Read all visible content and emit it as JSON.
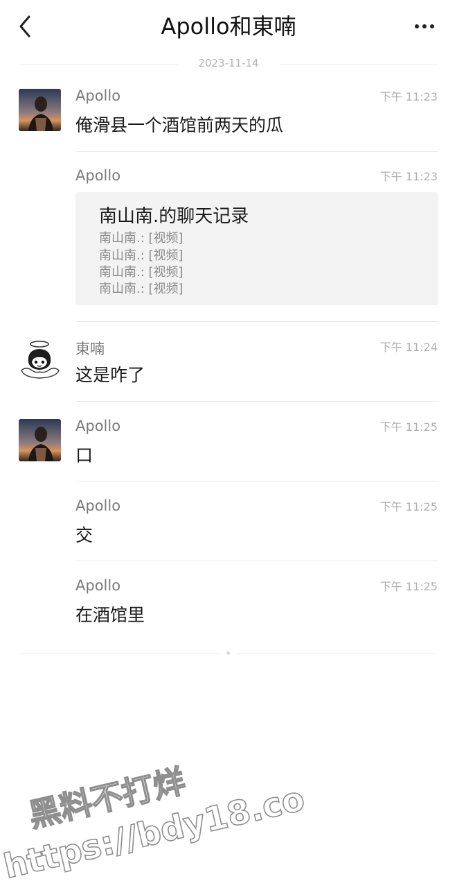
{
  "header": {
    "title": "Apollo和東喃",
    "back_icon": "chevron-left-icon",
    "more_icon": "more-horizontal-icon"
  },
  "date_separator": "2023-11-14",
  "messages": [
    {
      "sender": "Apollo",
      "time": "下午 11:23",
      "text": "俺滑县一个酒馆前两天的瓜",
      "avatar": "apollo"
    },
    {
      "sender": "Apollo",
      "time": "下午 11:23",
      "text": "",
      "avatar": "",
      "card": {
        "title": "南山南.的聊天记录",
        "lines": [
          "南山南.: [视频]",
          "南山南.: [视频]",
          "南山南.: [视频]",
          "南山南.: [视频]"
        ]
      }
    },
    {
      "sender": "東喃",
      "time": "下午 11:24",
      "text": "这是咋了",
      "avatar": "dongnan"
    },
    {
      "sender": "Apollo",
      "time": "下午 11:25",
      "text": "口",
      "avatar": "apollo"
    },
    {
      "sender": "Apollo",
      "time": "下午 11:25",
      "text": "交",
      "avatar": ""
    },
    {
      "sender": "Apollo",
      "time": "下午 11:25",
      "text": "在酒馆里",
      "avatar": ""
    }
  ],
  "watermark": {
    "line1": "黑料不打烊",
    "line2": "https://bdy18.co"
  },
  "colors": {
    "sender": "#7a7a7a",
    "time": "#b0b0b0",
    "card_bg": "#f3f3f3",
    "divider": "#e9e9e9"
  }
}
